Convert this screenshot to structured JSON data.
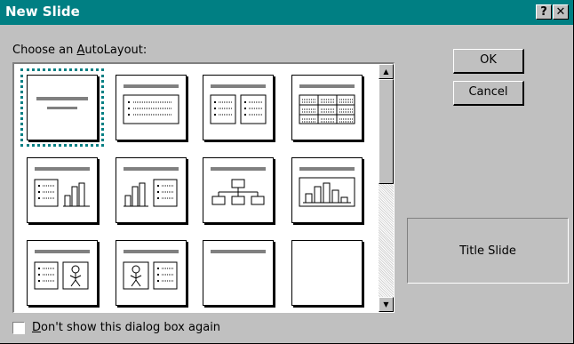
{
  "window": {
    "title": "New Slide",
    "help_glyph": "?",
    "close_glyph": "✕"
  },
  "autolayout": {
    "label_prefix": "Choose an ",
    "label_hotkey": "A",
    "label_suffix": "utoLayout:",
    "selected": "Title Slide",
    "layouts": [
      {
        "icon": "title-slide-layout-icon"
      },
      {
        "icon": "bulleted-list-layout-icon"
      },
      {
        "icon": "two-column-text-layout-icon"
      },
      {
        "icon": "table-layout-icon"
      },
      {
        "icon": "text-and-chart-layout-icon"
      },
      {
        "icon": "chart-and-text-layout-icon"
      },
      {
        "icon": "organization-chart-layout-icon"
      },
      {
        "icon": "chart-layout-icon"
      },
      {
        "icon": "text-and-clip-art-layout-icon"
      },
      {
        "icon": "clip-art-and-text-layout-icon"
      },
      {
        "icon": "title-only-layout-icon"
      },
      {
        "icon": "blank-layout-icon"
      }
    ]
  },
  "buttons": {
    "ok": "OK",
    "cancel": "Cancel"
  },
  "preview": {
    "name": "Title Slide"
  },
  "checkbox": {
    "hotkey": "D",
    "label_rest": "on't show this dialog box again",
    "checked": false
  },
  "colors": {
    "title_bar": "#007f83",
    "face": "#c0c0c0"
  }
}
